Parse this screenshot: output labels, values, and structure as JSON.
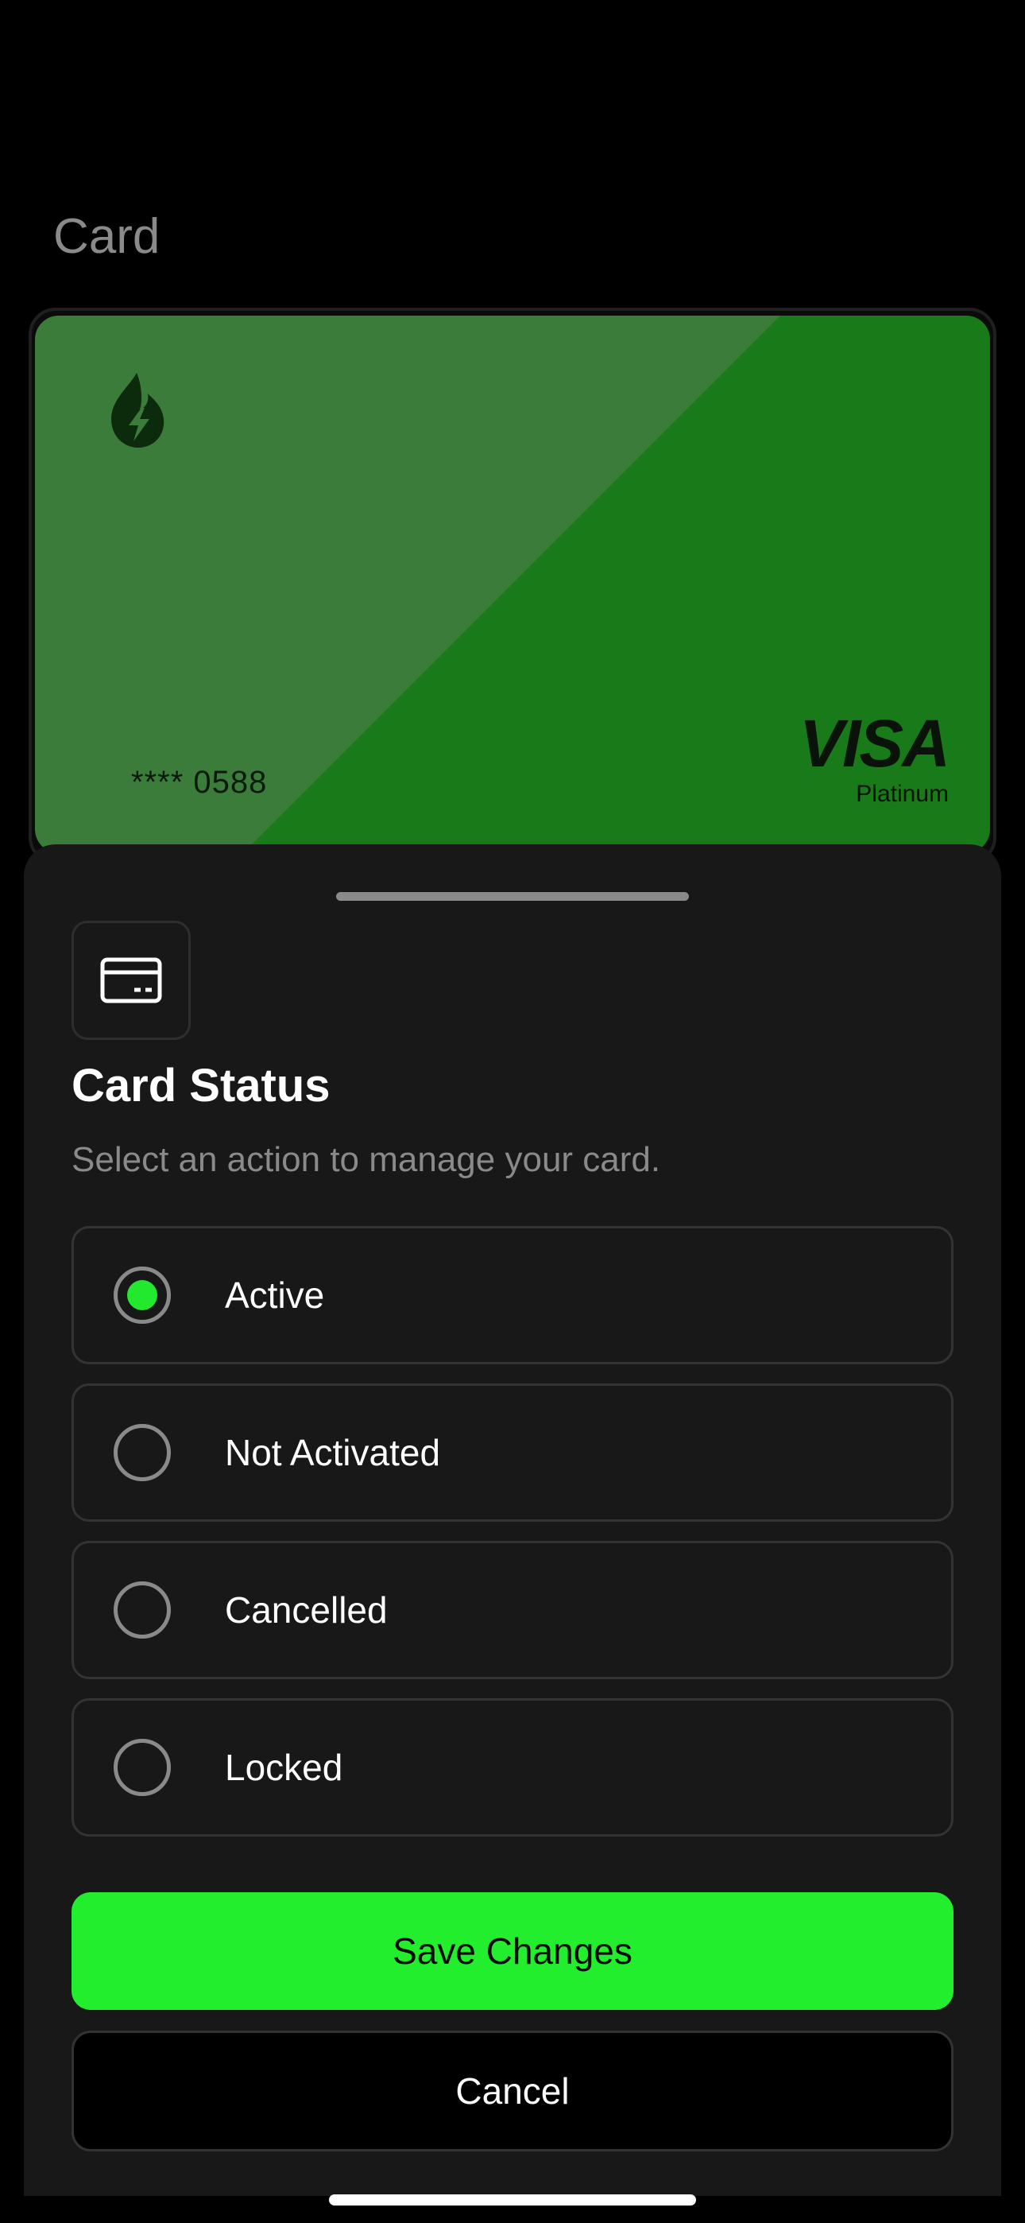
{
  "header": {
    "title": "Card"
  },
  "card": {
    "masked_number": "**** 0588",
    "network": "VISA",
    "tier": "Platinum",
    "colors": {
      "light": "#3b7c3b",
      "dark": "#197a19"
    },
    "logo_icon": "lightning-flame-icon"
  },
  "sheet": {
    "icon": "credit-card-icon",
    "title": "Card Status",
    "subtitle": "Select an action to manage your card.",
    "options": [
      {
        "label": "Active",
        "selected": true
      },
      {
        "label": "Not Activated",
        "selected": false
      },
      {
        "label": "Cancelled",
        "selected": false
      },
      {
        "label": "Locked",
        "selected": false
      }
    ],
    "save_label": "Save Changes",
    "cancel_label": "Cancel"
  },
  "colors": {
    "accent": "#22ee2e",
    "sheet_bg": "#181818",
    "border": "#333333"
  }
}
